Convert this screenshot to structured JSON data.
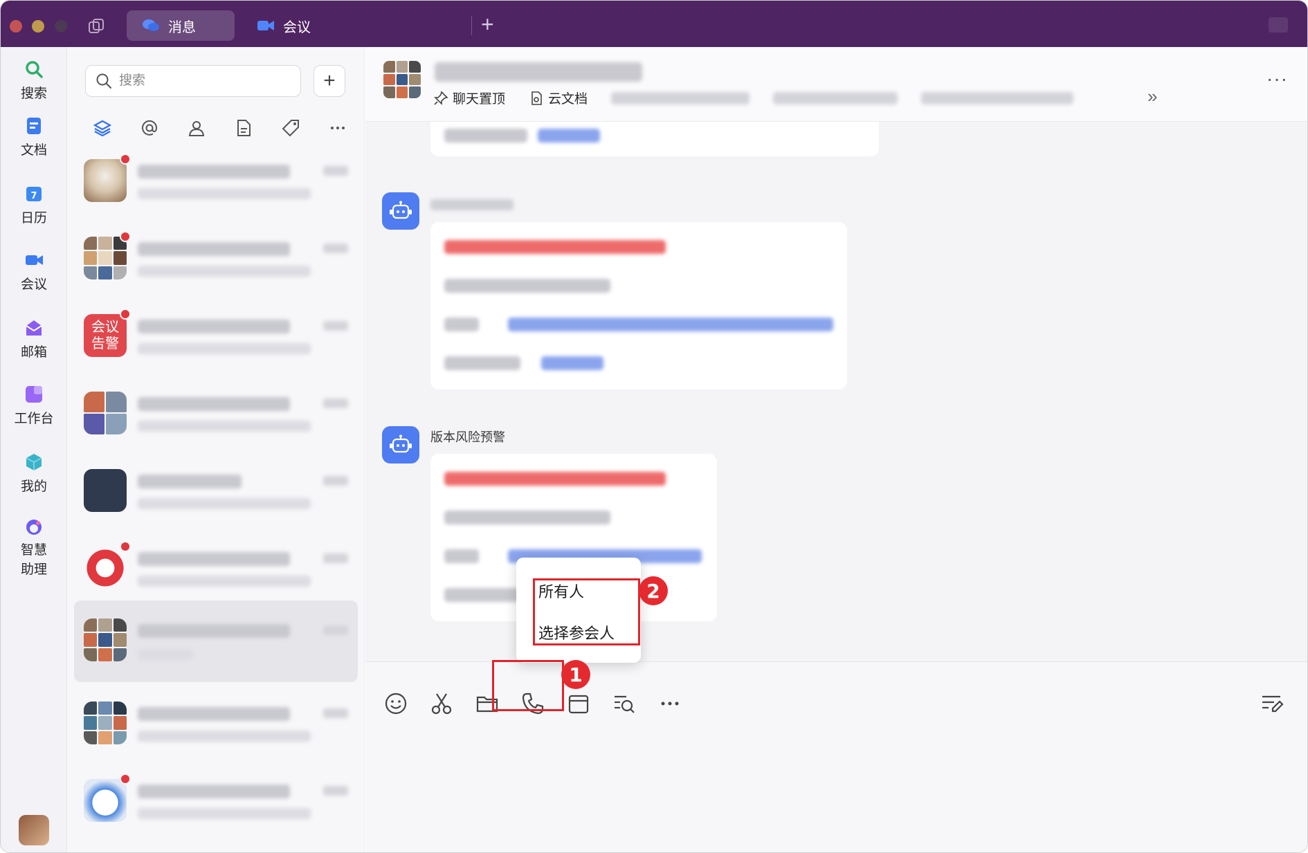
{
  "titlebar": {
    "tabs": [
      {
        "label": "消息",
        "icon": "chat-bubbles-icon",
        "active": true
      },
      {
        "label": "会议",
        "icon": "video-camera-icon",
        "active": false
      }
    ],
    "new_tab_label": "+",
    "colors": {
      "bar": "#4f2462",
      "active_tab": "#6b4a7d"
    }
  },
  "rail": {
    "items": [
      {
        "label": "搜索",
        "icon": "search-icon"
      },
      {
        "label": "文档",
        "icon": "document-icon"
      },
      {
        "label": "日历",
        "icon": "calendar-icon"
      },
      {
        "label": "会议",
        "icon": "video-camera-icon"
      },
      {
        "label": "邮箱",
        "icon": "mailbox-icon"
      },
      {
        "label": "工作台",
        "icon": "workbench-icon"
      },
      {
        "label": "我的",
        "icon": "cube-icon"
      },
      {
        "label": "智慧助理",
        "label_line1": "智慧",
        "label_line2": "助理",
        "icon": "assistant-icon"
      }
    ]
  },
  "conversation_list": {
    "search_placeholder": "搜索",
    "add_label": "+",
    "filters": [
      "layers-icon",
      "at-icon",
      "person-icon",
      "file-icon",
      "tag-icon",
      "more-icon"
    ],
    "items": [
      {
        "avatar": "cat-photo",
        "unread": true,
        "selected": false
      },
      {
        "avatar": "group-grid",
        "unread": true,
        "selected": false
      },
      {
        "avatar": "text-badge",
        "avatar_text_line1": "会议",
        "avatar_text_line2": "告警",
        "unread": true,
        "selected": false
      },
      {
        "avatar": "group-grid",
        "unread": false,
        "selected": false
      },
      {
        "avatar": "dark-calligraphy",
        "unread": false,
        "selected": false
      },
      {
        "avatar": "red-diamond",
        "unread": true,
        "selected": false
      },
      {
        "avatar": "group-grid",
        "unread": false,
        "selected": true
      },
      {
        "avatar": "group-grid",
        "unread": false,
        "selected": false
      },
      {
        "avatar": "cartoon",
        "unread": true,
        "selected": false
      }
    ]
  },
  "chat": {
    "header_tools": [
      {
        "label": "聊天置顶",
        "icon": "pin-icon"
      },
      {
        "label": "云文档",
        "icon": "cloud-doc-icon"
      }
    ],
    "more_label": "···",
    "expand_label": "»",
    "messages": [
      {
        "sender": "",
        "sender_blurred": true
      },
      {
        "sender": "版本风险预警",
        "sender_blurred": false
      }
    ]
  },
  "popup": {
    "options": [
      "所有人",
      "选择参会人"
    ]
  },
  "annotations": {
    "step1": "1",
    "step2": "2",
    "color": "#e2242b"
  },
  "composer": {
    "tools": [
      "emoji-icon",
      "scissors-icon",
      "folder-icon",
      "phone-icon",
      "calendar-icon",
      "search-history-icon",
      "more-icon"
    ],
    "right_tool": "edit-format-icon"
  }
}
